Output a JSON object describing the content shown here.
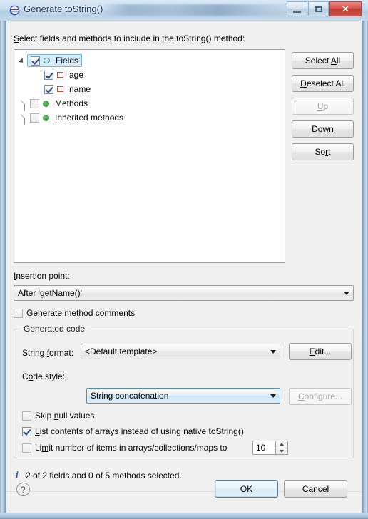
{
  "window": {
    "title": "Generate toString()",
    "icon": "eclipse-icon",
    "controls": {
      "minimize": "minimize-icon",
      "maximize": "maximize-icon",
      "close": "✕"
    }
  },
  "main": {
    "tree_prompt": "Select fields and methods to include in the toString() method:",
    "tree_prompt_mnemonic": "S",
    "tree": [
      {
        "label": "Fields",
        "icon": "fields-icon",
        "checked": true,
        "expanded": true,
        "has_children": true,
        "indent": 0,
        "selected": true
      },
      {
        "label": "age",
        "icon": "field-icon",
        "checked": true,
        "expanded": false,
        "has_children": false,
        "indent": 1,
        "selected": false
      },
      {
        "label": "name",
        "icon": "field-icon",
        "checked": true,
        "expanded": false,
        "has_children": false,
        "indent": 1,
        "selected": false
      },
      {
        "label": "Methods",
        "icon": "method-icon",
        "checked": false,
        "expanded": false,
        "has_children": true,
        "indent": 0,
        "selected": false
      },
      {
        "label": "Inherited methods",
        "icon": "method-icon",
        "checked": false,
        "expanded": false,
        "has_children": true,
        "indent": 0,
        "selected": false
      }
    ],
    "side_buttons": [
      {
        "label": "Select All",
        "mnemonic": "A",
        "enabled": true
      },
      {
        "label": "Deselect All",
        "mnemonic": "D",
        "enabled": true
      },
      {
        "label": "Up",
        "mnemonic": "U",
        "enabled": false
      },
      {
        "label": "Down",
        "mnemonic": "n",
        "enabled": true
      },
      {
        "label": "Sort",
        "mnemonic": "r",
        "enabled": true
      }
    ],
    "insertion_point": {
      "label": "Insertion point:",
      "mnemonic": "I",
      "value": "After 'getName()'"
    },
    "generate_comments": {
      "label": "Generate method comments",
      "mnemonic": "c",
      "checked": false
    },
    "generated_code": {
      "title": "Generated code",
      "string_format": {
        "label": "String format:",
        "mnemonic": "f",
        "value": "<Default template>",
        "button": {
          "label": "Edit...",
          "mnemonic": "E",
          "enabled": true
        }
      },
      "code_style": {
        "label": "Code style:",
        "mnemonic": "o",
        "value": "String concatenation",
        "button": {
          "label": "Configure...",
          "mnemonic": "C",
          "enabled": false
        }
      },
      "options": [
        {
          "label": "Skip null values",
          "mnemonic": "n",
          "checked": false
        },
        {
          "label": "List contents of arrays instead of using native toString()",
          "mnemonic": "L",
          "checked": true
        },
        {
          "label": "Limit number of items in arrays/collections/maps to",
          "mnemonic": "m",
          "checked": false
        }
      ],
      "limit_value": "10"
    }
  },
  "status": {
    "icon": "info-icon",
    "icon_glyph": "i",
    "text": "2 of 2 fields and 0 of 5 methods selected."
  },
  "footer": {
    "help": "?",
    "ok": "OK",
    "cancel": "Cancel"
  },
  "colors": {
    "dialog_bg": "#f0f0f0",
    "accent": "#3c7fb1",
    "info": "#2a5fa8",
    "selection": "#d6ebfb",
    "field_icon": "#c2554d",
    "method_icon": "#3c9546",
    "close_button": "#c0392b"
  }
}
